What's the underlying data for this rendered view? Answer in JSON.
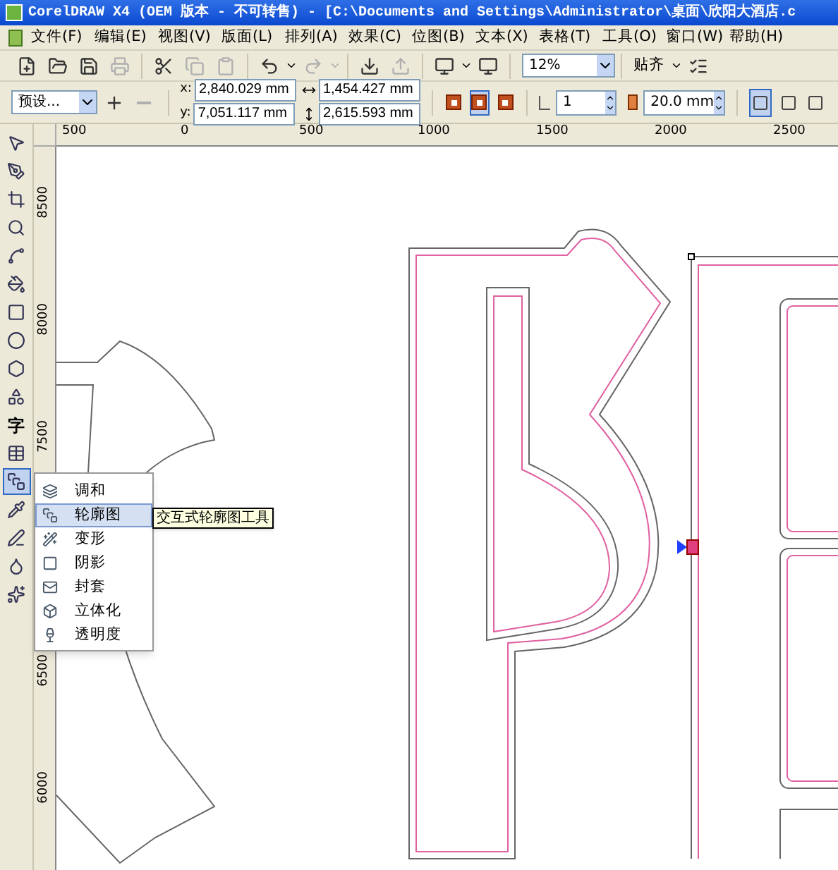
{
  "title_bar": {
    "title": "CorelDRAW X4 (OEM 版本 - 不可转售) - [C:\\Documents and Settings\\Administrator\\桌面\\欣阳大酒店.c"
  },
  "menu_bar": [
    "文件(F)",
    "编辑(E)",
    "视图(V)",
    "版面(L)",
    "排列(A)",
    "效果(C)",
    "位图(B)",
    "文本(X)",
    "表格(T)",
    "工具(O)",
    "窗口(W)",
    "帮助(H)"
  ],
  "standard_toolbar": {
    "zoom": "12%",
    "snap": "贴齐"
  },
  "property_bar": {
    "preset": "预设...",
    "x_label": "x:",
    "y_label": "y:",
    "x": "2,840.029 mm",
    "y": "7,051.117 mm",
    "width": "1,454.427 mm",
    "height": "2,615.593 mm",
    "contour_direction": [
      {
        "selected": false
      },
      {
        "selected": true
      },
      {
        "selected": false
      }
    ],
    "steps": "1",
    "offset": "20.0 mm",
    "color_direction": [
      {
        "selected": true
      },
      {
        "selected": false
      },
      {
        "selected": false
      }
    ]
  },
  "rulers": {
    "horizontal": [
      "500",
      "0",
      "500",
      "1000",
      "1500",
      "2000",
      "2500"
    ],
    "vertical": [
      "8500",
      "8000",
      "7500",
      "6500",
      "6000"
    ]
  },
  "toolbox": [
    {
      "kind": "icon",
      "selected": false
    },
    {
      "kind": "icon",
      "selected": false
    },
    {
      "kind": "icon",
      "selected": false
    },
    {
      "kind": "icon",
      "selected": false
    },
    {
      "kind": "icon",
      "selected": false
    },
    {
      "kind": "icon",
      "selected": false
    },
    {
      "kind": "icon",
      "selected": false
    },
    {
      "kind": "icon",
      "selected": false
    },
    {
      "kind": "icon",
      "selected": false
    },
    {
      "kind": "icon",
      "selected": false
    },
    {
      "kind": "text",
      "label": "字",
      "selected": false
    },
    {
      "kind": "icon",
      "selected": false
    },
    {
      "kind": "icon",
      "selected": true
    },
    {
      "kind": "icon",
      "selected": false
    },
    {
      "kind": "icon",
      "selected": false
    },
    {
      "kind": "icon",
      "selected": false
    },
    {
      "kind": "icon",
      "selected": false
    }
  ],
  "flyout": {
    "items": [
      {
        "label": "调和",
        "selected": false
      },
      {
        "label": "轮廓图",
        "selected": true
      },
      {
        "label": "变形",
        "selected": false
      },
      {
        "label": "阴影",
        "selected": false
      },
      {
        "label": "封套",
        "selected": false
      },
      {
        "label": "立体化",
        "selected": false
      },
      {
        "label": "透明度",
        "selected": false
      }
    ],
    "tooltip": "交互式轮廓图工具"
  }
}
